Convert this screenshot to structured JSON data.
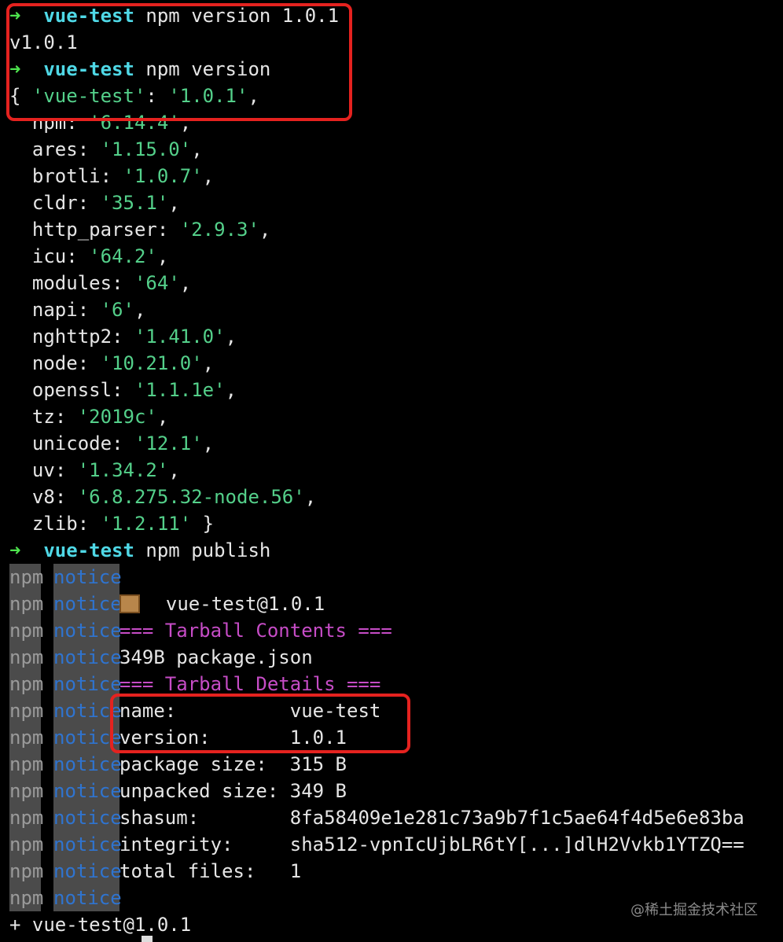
{
  "prompt": {
    "arrow": "➜",
    "dir": "vue-test"
  },
  "cmd1": "npm version 1.0.1",
  "out1": "v1.0.1",
  "cmd2": "npm version",
  "versions": [
    {
      "pre": "{ ",
      "key": "'vue-test'",
      "val": "'1.0.1'",
      "post": ","
    },
    {
      "pre": "  ",
      "key": "npm",
      "val": "'6.14.4'",
      "post": ","
    },
    {
      "pre": "  ",
      "key": "ares",
      "val": "'1.15.0'",
      "post": ","
    },
    {
      "pre": "  ",
      "key": "brotli",
      "val": "'1.0.7'",
      "post": ","
    },
    {
      "pre": "  ",
      "key": "cldr",
      "val": "'35.1'",
      "post": ","
    },
    {
      "pre": "  ",
      "key": "http_parser",
      "val": "'2.9.3'",
      "post": ","
    },
    {
      "pre": "  ",
      "key": "icu",
      "val": "'64.2'",
      "post": ","
    },
    {
      "pre": "  ",
      "key": "modules",
      "val": "'64'",
      "post": ","
    },
    {
      "pre": "  ",
      "key": "napi",
      "val": "'6'",
      "post": ","
    },
    {
      "pre": "  ",
      "key": "nghttp2",
      "val": "'1.41.0'",
      "post": ","
    },
    {
      "pre": "  ",
      "key": "node",
      "val": "'10.21.0'",
      "post": ","
    },
    {
      "pre": "  ",
      "key": "openssl",
      "val": "'1.1.1e'",
      "post": ","
    },
    {
      "pre": "  ",
      "key": "tz",
      "val": "'2019c'",
      "post": ","
    },
    {
      "pre": "  ",
      "key": "unicode",
      "val": "'12.1'",
      "post": ","
    },
    {
      "pre": "  ",
      "key": "uv",
      "val": "'1.34.2'",
      "post": ","
    },
    {
      "pre": "  ",
      "key": "v8",
      "val": "'6.8.275.32-node.56'",
      "post": ","
    },
    {
      "pre": "  ",
      "key": "zlib",
      "val": "'1.2.11'",
      "post": " }"
    }
  ],
  "cmd3": "npm publish",
  "npm_label": "npm",
  "notice_label": "notice",
  "notices": {
    "pkg": "vue-test@1.0.1",
    "contents_header": "=== Tarball Contents ===",
    "file": "349B package.json",
    "details_header": "=== Tarball Details ===",
    "name_k": "name:          ",
    "name_v": "vue-test",
    "version_k": "version:       ",
    "version_v": "1.0.1",
    "size_k": "package size:  ",
    "size_v": "315 B",
    "unpacked_k": "unpacked size: ",
    "unpacked_v": "349 B",
    "shasum_k": "shasum:        ",
    "shasum_v": "8fa58409e1e281c73a9b7f1c5ae64f4d5e6e83ba",
    "integrity_k": "integrity:     ",
    "integrity_v": "sha512-vpnIcUjbLR6tY[...]dlH2Vvkb1YTZQ==",
    "files_k": "total files:   ",
    "files_v": "1"
  },
  "final": "+ vue-test@1.0.1",
  "watermark": "@稀土掘金技术社区",
  "colors": {
    "accent_red": "#e5221f",
    "prompt_green": "#4ee44e",
    "dir_cyan": "#4fd8e6",
    "string_green": "#54d08a",
    "notice_blue": "#2f74d0",
    "magenta": "#c64cc6"
  }
}
